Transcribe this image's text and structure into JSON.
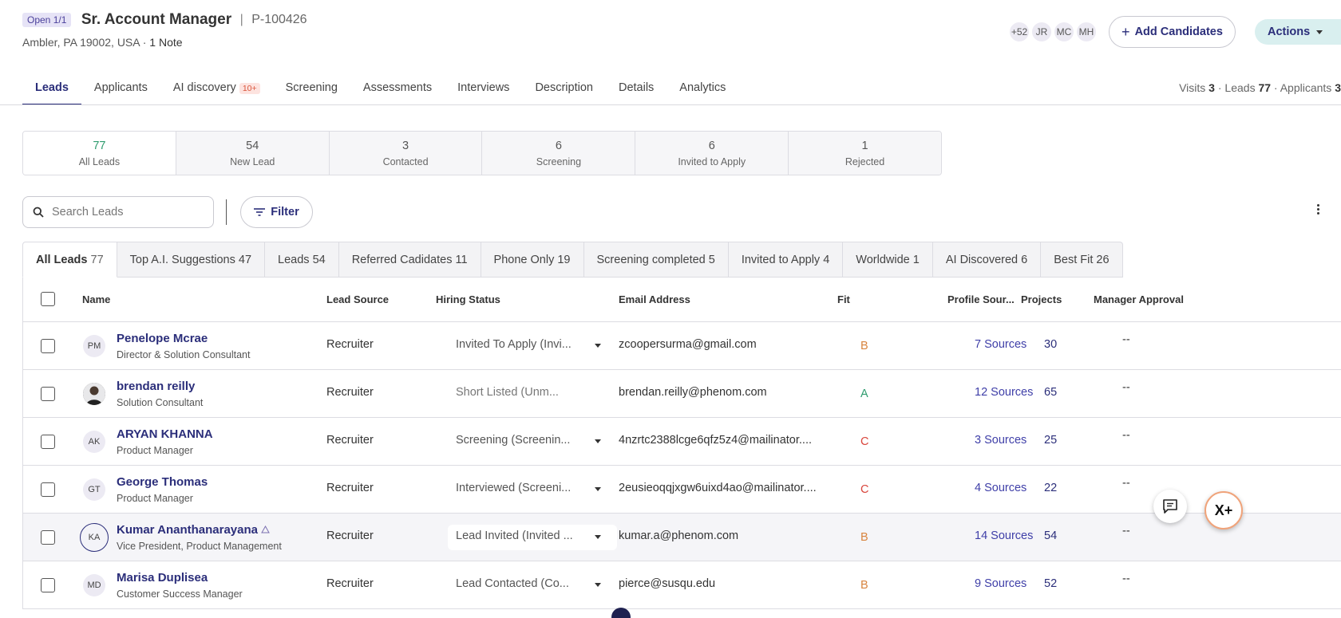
{
  "header": {
    "badge": "Open 1/1",
    "title": "Sr. Account Manager",
    "separator": "|",
    "job_id": "P-100426",
    "location": "Ambler, PA 19002, USA · ",
    "note": "1 Note"
  },
  "team": [
    "+52",
    "JR",
    "MC",
    "MH"
  ],
  "buttons": {
    "add_candidates": "Add Candidates",
    "actions": "Actions",
    "filter": "Filter"
  },
  "nav": {
    "tabs": [
      {
        "label": "Leads"
      },
      {
        "label": "Applicants"
      },
      {
        "label": "AI discovery",
        "badge": "10+"
      },
      {
        "label": "Screening"
      },
      {
        "label": "Assessments"
      },
      {
        "label": "Interviews"
      },
      {
        "label": "Description"
      },
      {
        "label": "Details"
      },
      {
        "label": "Analytics"
      }
    ],
    "stats": {
      "visits_label": "Visits",
      "visits": "3",
      "leads_label": "Leads",
      "leads": "77",
      "applicants_label": "Applicants",
      "applicants": "3"
    }
  },
  "stages": [
    {
      "count": "77",
      "label": "All Leads"
    },
    {
      "count": "54",
      "label": "New Lead"
    },
    {
      "count": "3",
      "label": "Contacted"
    },
    {
      "count": "6",
      "label": "Screening"
    },
    {
      "count": "6",
      "label": "Invited to Apply"
    },
    {
      "count": "1",
      "label": "Rejected"
    }
  ],
  "search": {
    "placeholder": "Search Leads"
  },
  "subtabs": [
    {
      "label": "All Leads",
      "count": "77"
    },
    {
      "label": "Top A.I. Suggestions",
      "count": "47"
    },
    {
      "label": "Leads",
      "count": "54"
    },
    {
      "label": "Referred Cadidates",
      "count": "11"
    },
    {
      "label": "Phone Only",
      "count": "19"
    },
    {
      "label": "Screening completed",
      "count": "5"
    },
    {
      "label": "Invited to Apply",
      "count": "4"
    },
    {
      "label": "Worldwide",
      "count": "1"
    },
    {
      "label": "AI Discovered",
      "count": "6"
    },
    {
      "label": "Best Fit",
      "count": "26"
    }
  ],
  "table": {
    "columns": [
      "Name",
      "Lead Source",
      "Hiring Status",
      "Email Address",
      "Fit",
      "Profile Sour...",
      "Projects",
      "Manager Approval"
    ],
    "rows": [
      {
        "initials": "PM",
        "name": "Penelope Mcrae",
        "title": "Director & Solution Consultant",
        "source": "Recruiter",
        "status": "Invited To Apply (Invi...",
        "email": "zcoopersurma@gmail.com",
        "fit": "B",
        "sources": "7 Sources",
        "projects": "30",
        "approval": "--"
      },
      {
        "initials": "",
        "name": "brendan reilly",
        "title": "Solution Consultant",
        "source": "Recruiter",
        "status": "Short Listed (Unm...",
        "email": "brendan.reilly@phenom.com",
        "fit": "A",
        "sources": "12 Sources",
        "projects": "65",
        "approval": "--"
      },
      {
        "initials": "AK",
        "name": "ARYAN KHANNA",
        "title": "Product Manager",
        "source": "Recruiter",
        "status": "Screening (Screenin...",
        "email": "4nzrtc2388lcge6qfz5z4@mailinator....",
        "fit": "C",
        "sources": "3 Sources",
        "projects": "25",
        "approval": "--"
      },
      {
        "initials": "GT",
        "name": "George Thomas",
        "title": "Product Manager",
        "source": "Recruiter",
        "status": "Interviewed (Screeni...",
        "email": "2eusieoqqjxgw6uixd4ao@mailinator....",
        "fit": "C",
        "sources": "4 Sources",
        "projects": "22",
        "approval": "--"
      },
      {
        "initials": "KA",
        "name": "Kumar Ananthanarayana",
        "title": "Vice President, Product Management",
        "source": "Recruiter",
        "status": "Lead Invited (Invited ...",
        "email": "kumar.a@phenom.com",
        "fit": "B",
        "sources": "14 Sources",
        "projects": "54",
        "approval": "--"
      },
      {
        "initials": "MD",
        "name": "Marisa Duplisea",
        "title": "Customer Success Manager",
        "source": "Recruiter",
        "status": "Lead Contacted (Co...",
        "email": "pierce@susqu.edu",
        "fit": "B",
        "sources": "9 Sources",
        "projects": "52",
        "approval": "--"
      }
    ]
  },
  "floating": {
    "assistant_label": "X+"
  },
  "colors": {
    "accent": "#2b2e7a",
    "fit_a": "#2f9c6f",
    "fit_b": "#d8843f",
    "fit_c": "#d9453c"
  }
}
